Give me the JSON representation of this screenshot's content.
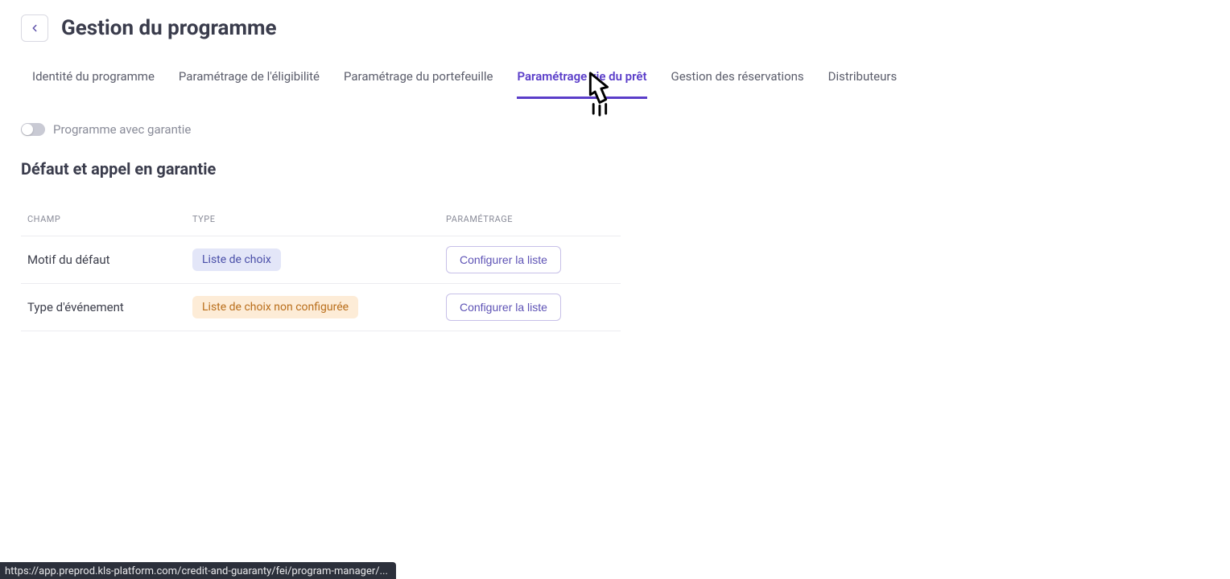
{
  "header": {
    "title": "Gestion du programme"
  },
  "tabs": [
    {
      "label": "Identité du programme",
      "active": false
    },
    {
      "label": "Paramétrage de l'éligibilité",
      "active": false
    },
    {
      "label": "Paramétrage du portefeuille",
      "active": false
    },
    {
      "label": "Paramétrage vie du prêt",
      "active": true
    },
    {
      "label": "Gestion des réservations",
      "active": false
    },
    {
      "label": "Distributeurs",
      "active": false
    }
  ],
  "toggle": {
    "label": "Programme avec garantie",
    "checked": false
  },
  "section": {
    "title": "Défaut et appel en garantie"
  },
  "table": {
    "headers": {
      "champ": "CHAMP",
      "type": "TYPE",
      "param": "PARAMÉTRAGE"
    },
    "rows": [
      {
        "champ": "Motif du défaut",
        "type_label": "Liste de choix",
        "type_variant": "blue",
        "action": "Configurer la liste"
      },
      {
        "champ": "Type d'événement",
        "type_label": "Liste de choix non configurée",
        "type_variant": "orange",
        "action": "Configurer la liste"
      }
    ]
  },
  "status_bar": {
    "text": "https://app.preprod.kls-platform.com/credit-and-guaranty/fei/program-manager/..."
  }
}
